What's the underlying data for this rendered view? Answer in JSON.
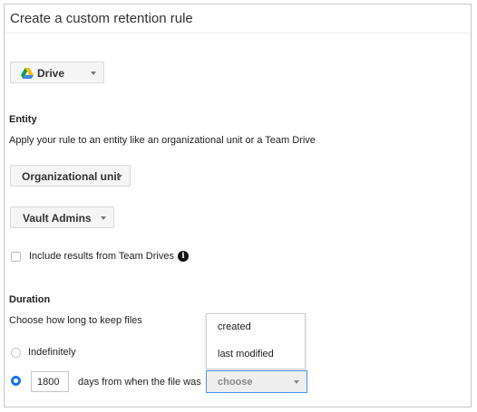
{
  "header": {
    "title": "Create a custom retention rule"
  },
  "service": {
    "label": "Drive",
    "icon": "google-drive-icon"
  },
  "entity": {
    "heading": "Entity",
    "description": "Apply your rule to an entity like an organizational unit or a Team Drive",
    "type_dropdown": "Organizational unit",
    "org_dropdown": "Vault Admins",
    "include_team_drives_label": "Include results from Team Drives",
    "include_team_drives_checked": false,
    "info_icon": "info-icon"
  },
  "duration": {
    "heading": "Duration",
    "description": "Choose how long to keep files",
    "option_indefinitely": "Indefinitely",
    "days_value": "1800",
    "days_text": "days from when the file was",
    "selected_option": "days",
    "choose_label": "choose",
    "menu_options": [
      "created",
      "last modified"
    ]
  },
  "colors": {
    "accent": "#1a73e8",
    "focus_border": "#4d90fe"
  }
}
